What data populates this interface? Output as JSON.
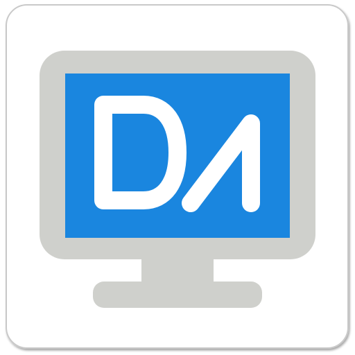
{
  "app_icon": {
    "name": "monitor-app-icon",
    "colors": {
      "tile_background": "#ffffff",
      "tile_border": "#c9c9c9",
      "monitor_frame": "#cfd0cc",
      "monitor_stand": "#cfd0cc",
      "screen": "#1a86df",
      "glyph": "#ffffff"
    },
    "glyph_icon": "da-logo-icon"
  }
}
